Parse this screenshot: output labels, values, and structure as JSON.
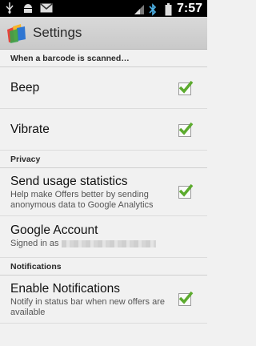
{
  "status_bar": {
    "time": "7:57",
    "icons_left": [
      "usb-icon",
      "android-debug-icon",
      "gmail-icon"
    ],
    "icons_right": [
      "signal-icon",
      "bluetooth-icon",
      "battery-icon"
    ]
  },
  "action_bar": {
    "title": "Settings",
    "app_icon": "offers-app-icon"
  },
  "sections": {
    "barcode": {
      "header": "When a barcode is scanned…"
    },
    "privacy": {
      "header": "Privacy"
    },
    "notifications": {
      "header": "Notifications"
    }
  },
  "items": {
    "beep": {
      "label": "Beep",
      "checked": true
    },
    "vibrate": {
      "label": "Vibrate",
      "checked": true
    },
    "usage": {
      "label": "Send usage statistics",
      "summary": "Help make Offers better by sending anonymous data to Google Analytics",
      "checked": true
    },
    "account": {
      "label": "Google Account",
      "summary_prefix": "Signed in as"
    },
    "notify": {
      "label": "Enable Notifications",
      "summary": "Notify in status bar when new offers are available",
      "checked": true
    }
  },
  "colors": {
    "check": "#5cab2e",
    "actionbar": "#d0d0d0",
    "background": "#f1f1f1"
  }
}
